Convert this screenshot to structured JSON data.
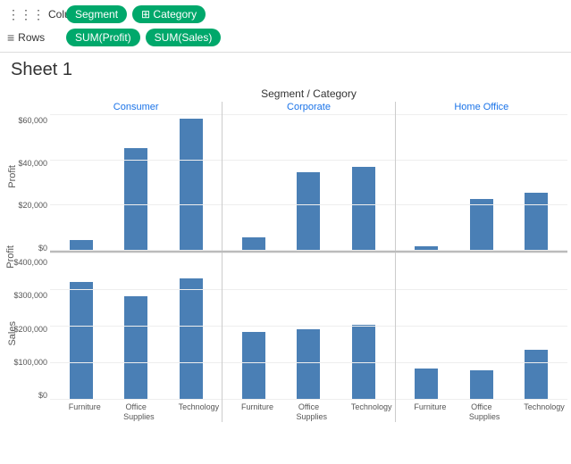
{
  "toolbar": {
    "columns_label": "Columns",
    "rows_label": "Rows",
    "columns_icon": "⋮⋮⋮",
    "rows_icon": "≡",
    "pills": {
      "segment": "Segment",
      "category": "⊞ Category",
      "sum_profit": "SUM(Profit)",
      "sum_sales": "SUM(Sales)"
    }
  },
  "sheet": {
    "title": "Sheet 1"
  },
  "chart": {
    "header": "Segment / Category",
    "segments": [
      "Consumer",
      "Corporate",
      "Home Office"
    ],
    "x_labels": {
      "consumer": [
        "Furniture",
        "Office Supplies",
        "Technology"
      ],
      "corporate": [
        "Furniture",
        "Office Supplies",
        "Technology"
      ],
      "home_office": [
        "Furniture",
        "Office Supplies",
        "Technology"
      ]
    },
    "profit_y_axis": [
      "$60,000",
      "$40,000",
      "$20,000",
      "$0"
    ],
    "sales_y_axis": [
      "$400,000",
      "$300,000",
      "$200,000",
      "$100,000",
      "$0"
    ],
    "profit_bars": {
      "consumer": [
        8,
        52,
        68
      ],
      "corporate": [
        10,
        40,
        43
      ],
      "home_office": [
        3,
        27,
        30
      ]
    },
    "sales_bars": {
      "consumer": [
        82,
        72,
        85
      ],
      "corporate": [
        47,
        49,
        52
      ],
      "home_office": [
        22,
        21,
        35
      ]
    },
    "y_labels": [
      "Profit",
      "Sales"
    ],
    "accent_color": "#4a7fb5",
    "segment_color": "#1a73e8"
  }
}
